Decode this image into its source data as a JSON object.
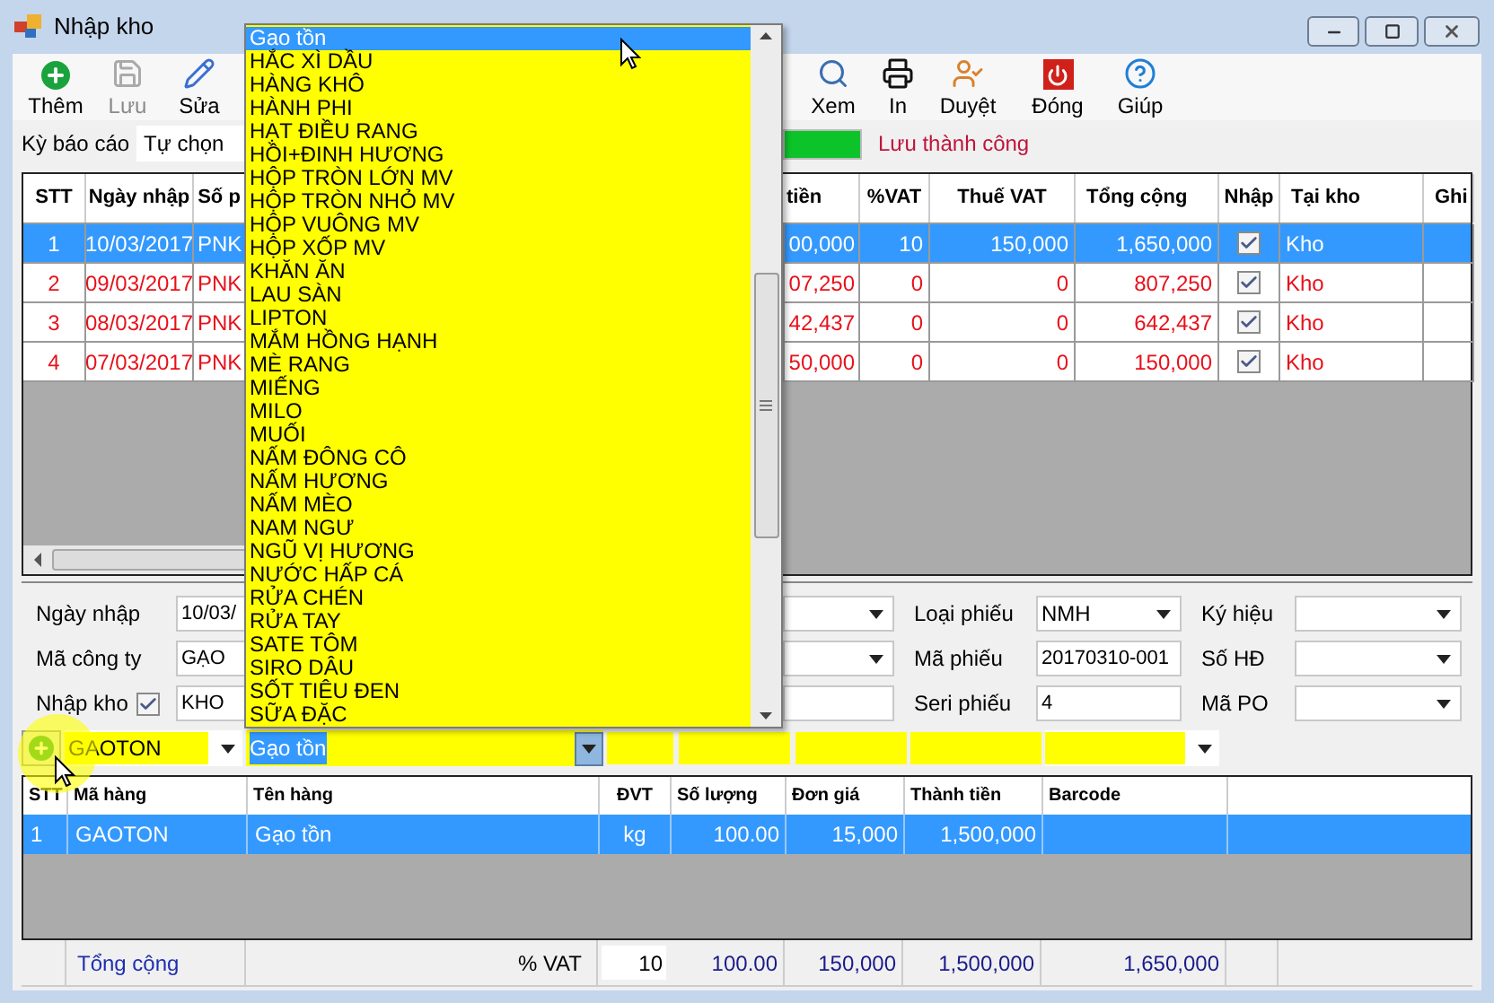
{
  "window": {
    "title": "Nhập kho"
  },
  "toolbar": [
    {
      "label": "Thêm",
      "disabled": false
    },
    {
      "label": "Lưu",
      "disabled": true
    },
    {
      "label": "Sửa",
      "disabled": false
    },
    {
      "label": "Xem",
      "disabled": false
    },
    {
      "label": "In",
      "disabled": false
    },
    {
      "label": "Duyệt",
      "disabled": false
    },
    {
      "label": "Đóng",
      "disabled": false
    },
    {
      "label": "Giúp",
      "disabled": false
    }
  ],
  "report_period": {
    "label": "Kỳ báo cáo",
    "value": "Tự chọn"
  },
  "progress": {
    "level": 1
  },
  "status_message": "Lưu thành công",
  "main_grid": {
    "columns_left": [
      "STT",
      "Ngày nhập",
      "Số p"
    ],
    "columns_right": [
      "tiền",
      "%VAT",
      "Thuế VAT",
      "Tổng cộng",
      "Nhập",
      "Tại kho",
      "Ghi"
    ],
    "rows": [
      {
        "stt": "1",
        "date": "10/03/2017",
        "doc": "PNK",
        "amount": "00,000",
        "vat": "10",
        "vat_amount": "150,000",
        "total": "1,650,000",
        "imported": true,
        "warehouse": "Kho",
        "selected": true
      },
      {
        "stt": "2",
        "date": "09/03/2017",
        "doc": "PNK",
        "amount": "07,250",
        "vat": "0",
        "vat_amount": "0",
        "total": "807,250",
        "imported": true,
        "warehouse": "Kho",
        "selected": false
      },
      {
        "stt": "3",
        "date": "08/03/2017",
        "doc": "PNK",
        "amount": "42,437",
        "vat": "0",
        "vat_amount": "0",
        "total": "642,437",
        "imported": true,
        "warehouse": "Kho",
        "selected": false
      },
      {
        "stt": "4",
        "date": "07/03/2017",
        "doc": "PNK",
        "amount": "50,000",
        "vat": "0",
        "vat_amount": "0",
        "total": "150,000",
        "imported": true,
        "warehouse": "Kho",
        "selected": false
      }
    ]
  },
  "form": {
    "left": [
      {
        "label": "Ngày nhập",
        "value": "10/03/"
      },
      {
        "label": "Mã công ty",
        "value": "GẠO"
      },
      {
        "label": "Nhập kho",
        "value": "KHO",
        "checked": true
      }
    ],
    "middle": [
      {
        "label": "Loại phiếu",
        "value": "NMH",
        "kind": "combo"
      },
      {
        "label": "Mã phiếu",
        "value": "20170310-001",
        "kind": "text"
      },
      {
        "label": "Seri phiếu",
        "value": "4",
        "kind": "text"
      }
    ],
    "right": [
      {
        "label": "Ký hiệu"
      },
      {
        "label": "Số HĐ"
      },
      {
        "label": "Mã PO"
      }
    ]
  },
  "item_entry": {
    "code": "GAOTON",
    "name": "Gạo tồn",
    "name_selected": true
  },
  "detail_grid": {
    "columns": [
      "STT",
      "Mã hàng",
      "Tên hàng",
      "ĐVT",
      "Số lượng",
      "Đơn giá",
      "Thành tiền",
      "Barcode"
    ],
    "rows": [
      {
        "cells": [
          "1",
          "GAOTON",
          "Gạo tồn",
          "kg",
          "100.00",
          "15,000",
          "1,500,000",
          ""
        ],
        "selected": true
      }
    ]
  },
  "totals": {
    "label": "Tổng cộng",
    "vat_label": "% VAT",
    "vat": "10",
    "quantity": "100.00",
    "price": "150,000",
    "amount": "1,500,000",
    "total": "1,650,000"
  },
  "dropdown": {
    "items": [
      {
        "label": "Gao tồn",
        "selected": true
      },
      {
        "label": "HẮC XÌ DẦU",
        "selected": false
      },
      {
        "label": "HÀNG KHÔ",
        "selected": false
      },
      {
        "label": "HÀNH PHI",
        "selected": false
      },
      {
        "label": "HẠT ĐIỀU RANG",
        "selected": false
      },
      {
        "label": "HỒI+ĐINH HƯƠNG",
        "selected": false
      },
      {
        "label": "HỘP TRÒN LỚN MV",
        "selected": false
      },
      {
        "label": "HỘP TRÒN NHỎ MV",
        "selected": false
      },
      {
        "label": "HỘP VUÔNG MV",
        "selected": false
      },
      {
        "label": "HỘP XỐP MV",
        "selected": false
      },
      {
        "label": "KHĂN ĂN",
        "selected": false
      },
      {
        "label": "LAU SÀN",
        "selected": false
      },
      {
        "label": "LIPTON",
        "selected": false
      },
      {
        "label": "MẮM HỒNG HẠNH",
        "selected": false
      },
      {
        "label": "MÈ RANG",
        "selected": false
      },
      {
        "label": "MIẾNG",
        "selected": false
      },
      {
        "label": "MILO",
        "selected": false
      },
      {
        "label": "MUỐI",
        "selected": false
      },
      {
        "label": "NẤM ĐÔNG CÔ",
        "selected": false
      },
      {
        "label": "NẤM HƯƠNG",
        "selected": false
      },
      {
        "label": "NẤM MÈO",
        "selected": false
      },
      {
        "label": "NAM NGƯ",
        "selected": false
      },
      {
        "label": "NGŨ VỊ HƯƠNG",
        "selected": false
      },
      {
        "label": "NƯỚC HẤP CÁ",
        "selected": false
      },
      {
        "label": "RỬA CHÉN",
        "selected": false
      },
      {
        "label": "RỬA TAY",
        "selected": false
      },
      {
        "label": "SATE TÔM",
        "selected": false
      },
      {
        "label": "SIRO DÂU",
        "selected": false
      },
      {
        "label": "SỐT TIÊU ĐEN",
        "selected": false
      },
      {
        "label": "SỮA ĐẶC",
        "selected": false
      }
    ]
  }
}
